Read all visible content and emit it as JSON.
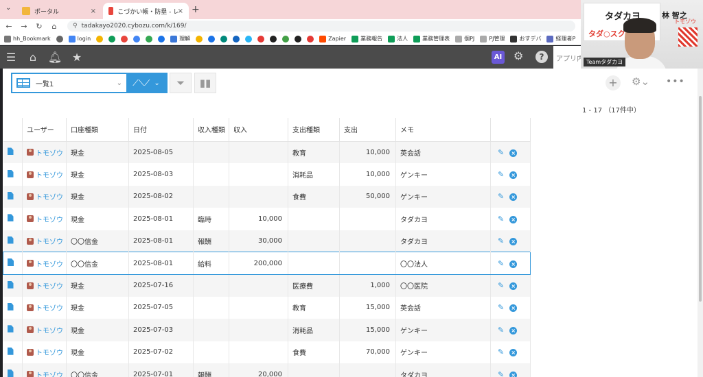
{
  "browser": {
    "tabs": [
      {
        "label": "ポータル"
      },
      {
        "label": "こづかい帳・防塁 - レコードの一覧"
      }
    ],
    "url": "tadakayo2020.cybozu.com/k/169/",
    "bookmarks": [
      {
        "label": "hh_Bookmark"
      },
      {
        "label": "login"
      },
      {
        "label": "理解"
      },
      {
        "label": "Zapier"
      },
      {
        "label": "業務報告"
      },
      {
        "label": "法人"
      },
      {
        "label": "業務管理表"
      },
      {
        "label": "個PJ"
      },
      {
        "label": "PJ管理"
      },
      {
        "label": "おすデバ"
      },
      {
        "label": "経理者P"
      }
    ]
  },
  "app_header": {
    "ai_label": "AI",
    "app_label": "アプリ内"
  },
  "overlay": {
    "brand": "タダカヨ",
    "sub_brand": "タダ○スク",
    "name": "林 智之",
    "name_kana": "トモゾウ",
    "team": "Teamタダカヨ"
  },
  "view": {
    "name": "一覧1"
  },
  "pager": {
    "text": "1 - 17 （17件中）"
  },
  "table": {
    "columns": [
      "",
      "ユーザー",
      "口座種類",
      "日付",
      "収入種類",
      "収入",
      "支出種類",
      "支出",
      "メモ",
      ""
    ],
    "rows": [
      {
        "user": "トモゾウ",
        "account": "現金",
        "date": "2025-08-05",
        "income_type": "",
        "income": "",
        "expense_type": "教育",
        "expense": "10,000",
        "memo": "英会話"
      },
      {
        "user": "トモゾウ",
        "account": "現金",
        "date": "2025-08-03",
        "income_type": "",
        "income": "",
        "expense_type": "消耗品",
        "expense": "10,000",
        "memo": "ゲンキー"
      },
      {
        "user": "トモゾウ",
        "account": "現金",
        "date": "2025-08-02",
        "income_type": "",
        "income": "",
        "expense_type": "食費",
        "expense": "50,000",
        "memo": "ゲンキー"
      },
      {
        "user": "トモゾウ",
        "account": "現金",
        "date": "2025-08-01",
        "income_type": "臨時",
        "income": "10,000",
        "expense_type": "",
        "expense": "",
        "memo": "タダカヨ"
      },
      {
        "user": "トモゾウ",
        "account": "〇〇信金",
        "date": "2025-08-01",
        "income_type": "報酬",
        "income": "30,000",
        "expense_type": "",
        "expense": "",
        "memo": "タダカヨ"
      },
      {
        "user": "トモゾウ",
        "account": "〇〇信金",
        "date": "2025-08-01",
        "income_type": "給料",
        "income": "200,000",
        "expense_type": "",
        "expense": "",
        "memo": "〇〇法人"
      },
      {
        "user": "トモゾウ",
        "account": "現金",
        "date": "2025-07-16",
        "income_type": "",
        "income": "",
        "expense_type": "医療費",
        "expense": "1,000",
        "memo": "〇〇医院"
      },
      {
        "user": "トモゾウ",
        "account": "現金",
        "date": "2025-07-05",
        "income_type": "",
        "income": "",
        "expense_type": "教育",
        "expense": "15,000",
        "memo": "英会話"
      },
      {
        "user": "トモゾウ",
        "account": "現金",
        "date": "2025-07-03",
        "income_type": "",
        "income": "",
        "expense_type": "消耗品",
        "expense": "15,000",
        "memo": "ゲンキー"
      },
      {
        "user": "トモゾウ",
        "account": "現金",
        "date": "2025-07-02",
        "income_type": "",
        "income": "",
        "expense_type": "食費",
        "expense": "70,000",
        "memo": "ゲンキー"
      },
      {
        "user": "トモゾウ",
        "account": "〇〇信金",
        "date": "2025-07-01",
        "income_type": "報酬",
        "income": "20,000",
        "expense_type": "",
        "expense": "",
        "memo": "タダカヨ"
      }
    ],
    "selected_row": 5
  }
}
